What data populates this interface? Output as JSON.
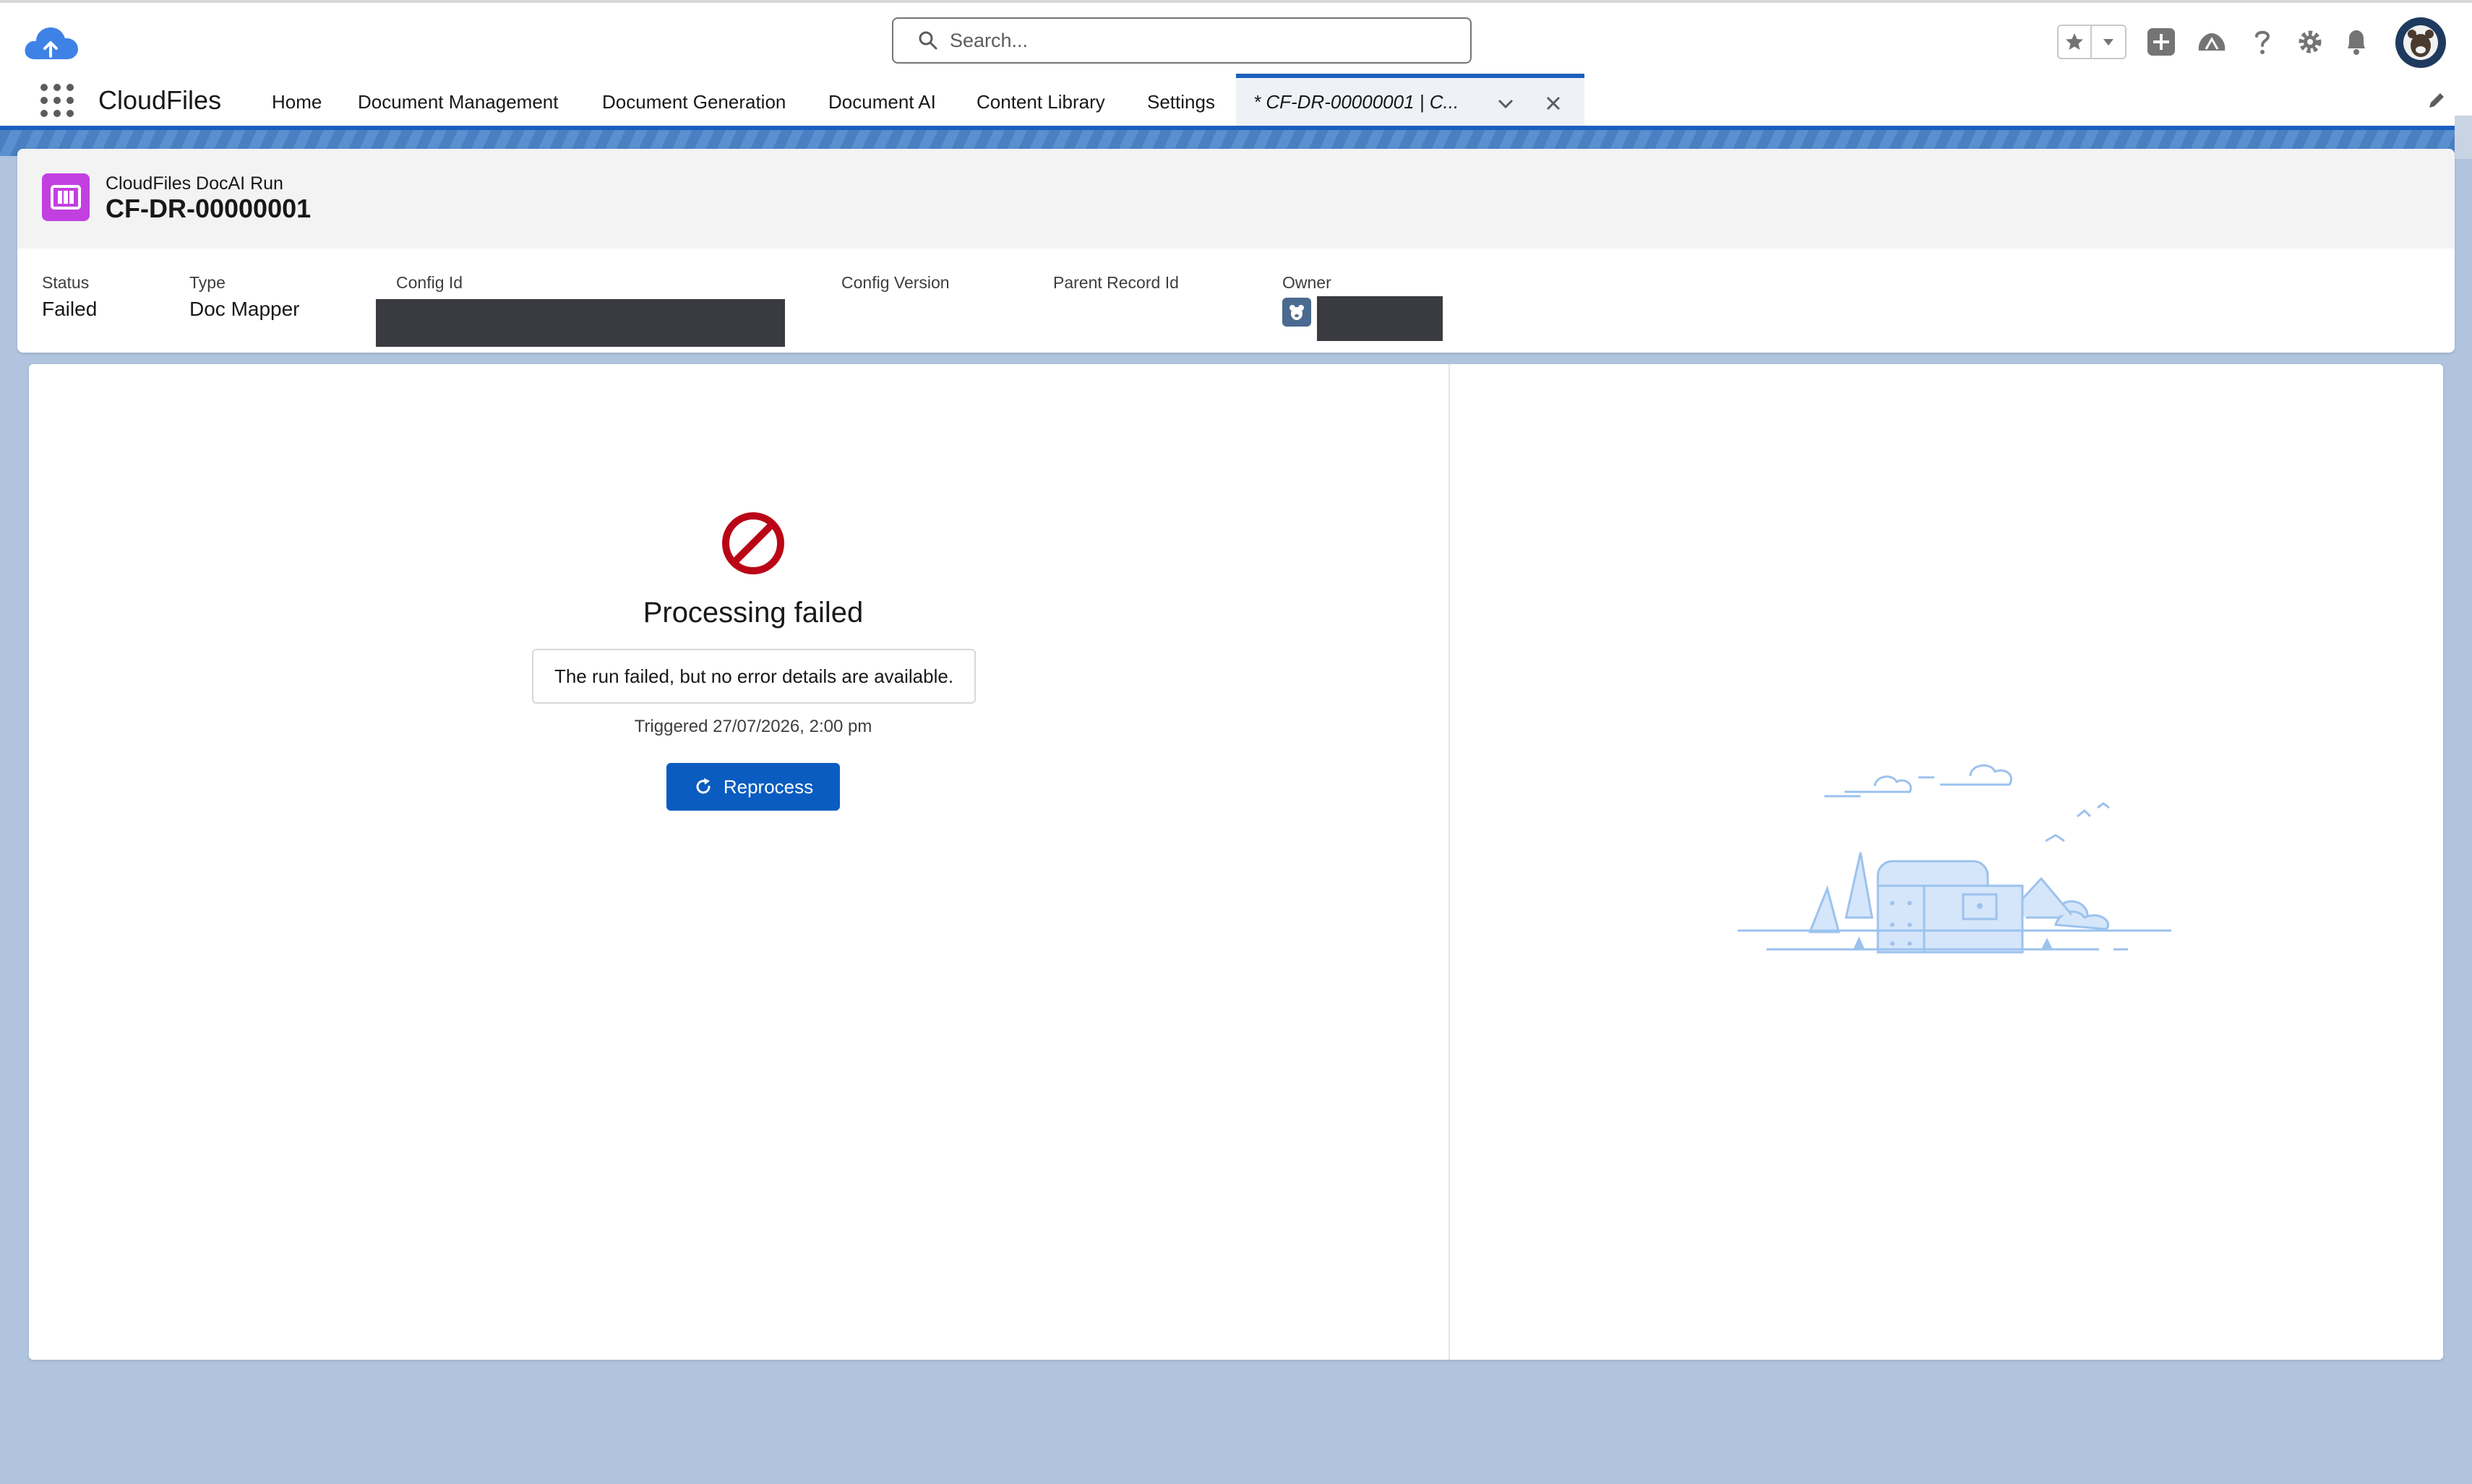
{
  "header": {
    "app_logo": "cloud-upload-logo",
    "search": {
      "placeholder": "Search..."
    },
    "tools": [
      "favorites-star-icon",
      "chevron-down-icon",
      "add-icon",
      "trailhead-icon",
      "help-icon",
      "setup-gear-icon",
      "notifications-bell-icon",
      "avatar"
    ]
  },
  "nav": {
    "app_name": "CloudFiles",
    "items": [
      "Home",
      "Document Management",
      "Document Generation",
      "Document AI",
      "Content Library",
      "Settings"
    ],
    "active_tab": {
      "label": "* CF-DR-00000001 | C..."
    }
  },
  "record": {
    "object_type": "CloudFiles DocAI Run",
    "name": "CF-DR-00000001",
    "fields": {
      "status": {
        "label": "Status",
        "value": "Failed"
      },
      "type": {
        "label": "Type",
        "value": "Doc Mapper"
      },
      "config_id": {
        "label": "Config Id",
        "value": ""
      },
      "config_version": {
        "label": "Config Version",
        "value": ""
      },
      "parent_record_id": {
        "label": "Parent Record Id",
        "value": ""
      },
      "owner": {
        "label": "Owner",
        "value": ""
      }
    }
  },
  "main": {
    "title": "Processing failed",
    "message": "The run failed, but no error details are available.",
    "triggered": "Triggered 27/07/2026, 2:00 pm",
    "reprocess_label": "Reprocess"
  },
  "colors": {
    "brand_blue": "#0b5cc0",
    "error_red": "#ba0517",
    "record_icon": "#c23fe0",
    "page_bg": "#b0c4df"
  }
}
